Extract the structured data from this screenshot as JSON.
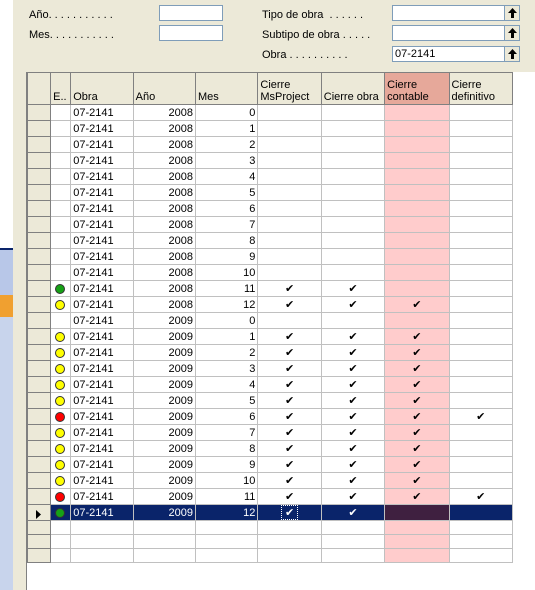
{
  "filters": {
    "anio_label": "Año. . . . . . . . . . .",
    "anio_value": "",
    "mes_label": "Mes. . . . . . . . . . .",
    "mes_value": "",
    "tipo_label": "Tipo de obra  . . . . . .",
    "tipo_value": "",
    "subtipo_label": "Subtipo de obra . . . . .",
    "subtipo_value": "",
    "obra_label": "Obra . . . . . . . . . .",
    "obra_value": "07-2141"
  },
  "grid": {
    "headers": {
      "estado": "E..",
      "obra": "Obra",
      "anio": "Año",
      "mes": "Mes",
      "cierre_msproject": "Cierre\nMsProject",
      "cierre_obra": "Cierre obra",
      "cierre_contable": "Cierre\ncontable",
      "cierre_definitivo": "Cierre\ndefinitivo"
    },
    "check_glyph": "✔",
    "rows": [
      {
        "status": "",
        "obra": "07-2141",
        "anio": "2008",
        "mes": "0",
        "msp": false,
        "obra_c": false,
        "contable": false,
        "def": false
      },
      {
        "status": "",
        "obra": "07-2141",
        "anio": "2008",
        "mes": "1",
        "msp": false,
        "obra_c": false,
        "contable": false,
        "def": false
      },
      {
        "status": "",
        "obra": "07-2141",
        "anio": "2008",
        "mes": "2",
        "msp": false,
        "obra_c": false,
        "contable": false,
        "def": false
      },
      {
        "status": "",
        "obra": "07-2141",
        "anio": "2008",
        "mes": "3",
        "msp": false,
        "obra_c": false,
        "contable": false,
        "def": false
      },
      {
        "status": "",
        "obra": "07-2141",
        "anio": "2008",
        "mes": "4",
        "msp": false,
        "obra_c": false,
        "contable": false,
        "def": false
      },
      {
        "status": "",
        "obra": "07-2141",
        "anio": "2008",
        "mes": "5",
        "msp": false,
        "obra_c": false,
        "contable": false,
        "def": false
      },
      {
        "status": "",
        "obra": "07-2141",
        "anio": "2008",
        "mes": "6",
        "msp": false,
        "obra_c": false,
        "contable": false,
        "def": false
      },
      {
        "status": "",
        "obra": "07-2141",
        "anio": "2008",
        "mes": "7",
        "msp": false,
        "obra_c": false,
        "contable": false,
        "def": false
      },
      {
        "status": "",
        "obra": "07-2141",
        "anio": "2008",
        "mes": "8",
        "msp": false,
        "obra_c": false,
        "contable": false,
        "def": false
      },
      {
        "status": "",
        "obra": "07-2141",
        "anio": "2008",
        "mes": "9",
        "msp": false,
        "obra_c": false,
        "contable": false,
        "def": false
      },
      {
        "status": "",
        "obra": "07-2141",
        "anio": "2008",
        "mes": "10",
        "msp": false,
        "obra_c": false,
        "contable": false,
        "def": false
      },
      {
        "status": "green",
        "obra": "07-2141",
        "anio": "2008",
        "mes": "11",
        "msp": true,
        "obra_c": true,
        "contable": false,
        "def": false
      },
      {
        "status": "yellow",
        "obra": "07-2141",
        "anio": "2008",
        "mes": "12",
        "msp": true,
        "obra_c": true,
        "contable": true,
        "def": false
      },
      {
        "status": "",
        "obra": "07-2141",
        "anio": "2009",
        "mes": "0",
        "msp": false,
        "obra_c": false,
        "contable": false,
        "def": false
      },
      {
        "status": "yellow",
        "obra": "07-2141",
        "anio": "2009",
        "mes": "1",
        "msp": true,
        "obra_c": true,
        "contable": true,
        "def": false
      },
      {
        "status": "yellow",
        "obra": "07-2141",
        "anio": "2009",
        "mes": "2",
        "msp": true,
        "obra_c": true,
        "contable": true,
        "def": false
      },
      {
        "status": "yellow",
        "obra": "07-2141",
        "anio": "2009",
        "mes": "3",
        "msp": true,
        "obra_c": true,
        "contable": true,
        "def": false
      },
      {
        "status": "yellow",
        "obra": "07-2141",
        "anio": "2009",
        "mes": "4",
        "msp": true,
        "obra_c": true,
        "contable": true,
        "def": false
      },
      {
        "status": "yellow",
        "obra": "07-2141",
        "anio": "2009",
        "mes": "5",
        "msp": true,
        "obra_c": true,
        "contable": true,
        "def": false
      },
      {
        "status": "red",
        "obra": "07-2141",
        "anio": "2009",
        "mes": "6",
        "msp": true,
        "obra_c": true,
        "contable": true,
        "def": true
      },
      {
        "status": "yellow",
        "obra": "07-2141",
        "anio": "2009",
        "mes": "7",
        "msp": true,
        "obra_c": true,
        "contable": true,
        "def": false
      },
      {
        "status": "yellow",
        "obra": "07-2141",
        "anio": "2009",
        "mes": "8",
        "msp": true,
        "obra_c": true,
        "contable": true,
        "def": false
      },
      {
        "status": "yellow",
        "obra": "07-2141",
        "anio": "2009",
        "mes": "9",
        "msp": true,
        "obra_c": true,
        "contable": true,
        "def": false
      },
      {
        "status": "yellow",
        "obra": "07-2141",
        "anio": "2009",
        "mes": "10",
        "msp": true,
        "obra_c": true,
        "contable": true,
        "def": false
      },
      {
        "status": "red",
        "obra": "07-2141",
        "anio": "2009",
        "mes": "11",
        "msp": true,
        "obra_c": true,
        "contable": true,
        "def": true
      },
      {
        "status": "green",
        "obra": "07-2141",
        "anio": "2009",
        "mes": "12",
        "msp": true,
        "obra_c": true,
        "contable": false,
        "def": false,
        "current": true
      }
    ]
  },
  "colors": {
    "status_green": "#16a116",
    "status_yellow": "#ffff00",
    "status_red": "#ff0000",
    "selection": "#0a246a",
    "contable_column": "#ffcccc"
  }
}
